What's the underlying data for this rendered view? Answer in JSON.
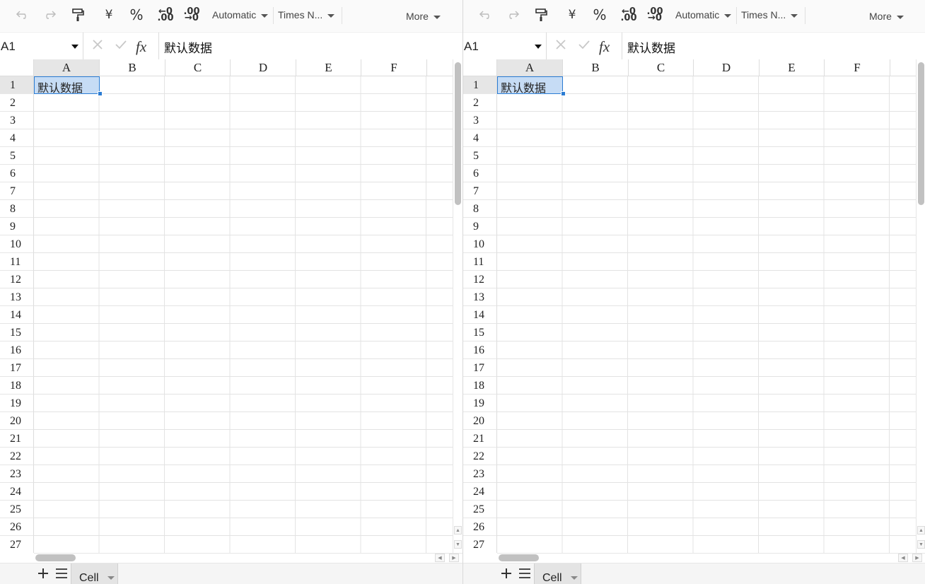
{
  "toolbar": {
    "undo_icon": "undo-icon",
    "redo_icon": "redo-icon",
    "format_painter_icon": "paint-roller-icon",
    "currency_symbol": "¥",
    "percent_symbol": "%",
    "decrease_decimal": {
      "top": "←0",
      "bottom": ".00"
    },
    "increase_decimal": {
      "top": ".00",
      "bottom": "→0"
    },
    "number_format": "Automatic",
    "font_name": "Times N...",
    "more_label": "More"
  },
  "formula_bar": {
    "cell_ref": "A1",
    "fx_label": "fx",
    "content": "默认数据"
  },
  "grid": {
    "columns": [
      "A",
      "B",
      "C",
      "D",
      "E",
      "F"
    ],
    "rows": [
      "1",
      "2",
      "3",
      "4",
      "5",
      "6",
      "7",
      "8",
      "9",
      "10",
      "11",
      "12",
      "13",
      "14",
      "15",
      "16",
      "17",
      "18",
      "19",
      "20",
      "21",
      "22",
      "23",
      "24",
      "25",
      "26",
      "27"
    ],
    "selected_cell": "A1",
    "selected_cell_value": "默认数据"
  },
  "sheet_bar": {
    "add_icon": "plus-icon",
    "list_icon": "menu-icon",
    "active_sheet": "Cell"
  },
  "colors": {
    "selection_fill": "#c6dcf5",
    "selection_border": "#2b7cd3",
    "header_selected": "#e6e6e6"
  }
}
